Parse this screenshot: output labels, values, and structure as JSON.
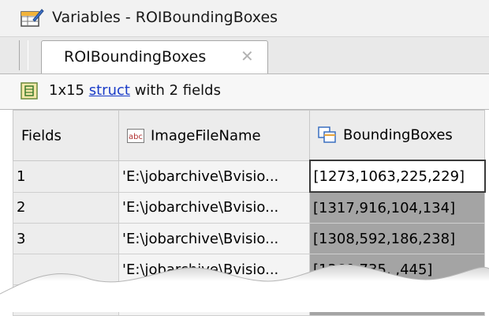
{
  "window": {
    "title": "Variables - ROIBoundingBoxes",
    "icon": "variables-editor-icon"
  },
  "tabs": [
    {
      "label": "ROIBoundingBoxes",
      "close_icon": "close-x-icon"
    }
  ],
  "summary": {
    "icon": "struct-array-icon",
    "prefix": "1x15",
    "link": "struct",
    "suffix": "with 2 fields"
  },
  "table": {
    "columns": [
      {
        "label": "Fields"
      },
      {
        "label": "ImageFileName",
        "icon": "abc-string-icon"
      },
      {
        "label": "BoundingBoxes",
        "icon": "copy-matrix-icon"
      }
    ],
    "rows": [
      {
        "index": "1",
        "image": "'E:\\jobarchive\\Bvisio...",
        "boxes": "[1273,1063,225,229]"
      },
      {
        "index": "2",
        "image": "'E:\\jobarchive\\Bvisio...",
        "boxes": "[1317,916,104,134]"
      },
      {
        "index": "3",
        "image": "'E:\\jobarchive\\Bvisio...",
        "boxes": "[1308,592,186,238]"
      },
      {
        "index": "",
        "image": "'E:\\jobarchive\\Bvisio...",
        "boxes": "[1360,735,  ,445]"
      },
      {
        "index": "",
        "image": "",
        "boxes": ""
      }
    ]
  },
  "colors": {
    "selected_cell_border": "#3a3a3a",
    "boxes_column": "#a4a4a4",
    "link": "#1a3cc8"
  }
}
